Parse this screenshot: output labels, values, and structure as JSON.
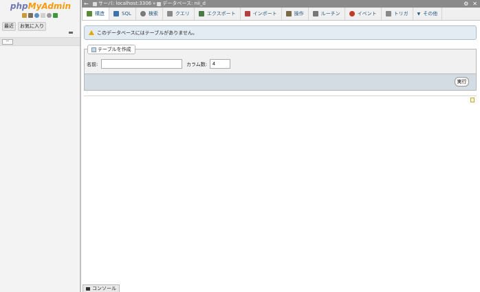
{
  "nav": {
    "logo_php": "php",
    "logo_myadmin": "MyAdmin",
    "icons": [
      "home-icon",
      "table-icon",
      "info-icon",
      "docs-icon",
      "settings-icon",
      "reload-icon"
    ],
    "recent_label": "最近",
    "favorites_label": "お気に入り",
    "tree_icon_label": "ー"
  },
  "topbar": {
    "collapse_glyph": "←",
    "server_label": "サーバ: localhost:3306",
    "separator": "»",
    "database_label": "データベース: nii_d",
    "settings_glyph": "⚙",
    "close_glyph": "✕"
  },
  "tabs": [
    {
      "name": "structure",
      "label": "構造",
      "icon": "structure-icon",
      "color": "#5a8a3a"
    },
    {
      "name": "sql",
      "label": "SQL",
      "icon": "sql-icon",
      "color": "#3f73a8"
    },
    {
      "name": "search",
      "label": "検索",
      "icon": "search-icon",
      "color": "#7a7a7a"
    },
    {
      "name": "query",
      "label": "クエリ",
      "icon": "query-icon",
      "color": "#8a8a8a"
    },
    {
      "name": "export",
      "label": "エクスポート",
      "icon": "export-icon",
      "color": "#4a7a4a"
    },
    {
      "name": "import",
      "label": "インポート",
      "icon": "import-icon",
      "color": "#b04040"
    },
    {
      "name": "operations",
      "label": "操作",
      "icon": "wrench-icon",
      "color": "#7a6a4a"
    },
    {
      "name": "routines",
      "label": "ルーチン",
      "icon": "routines-icon",
      "color": "#777777"
    },
    {
      "name": "events",
      "label": "イベント",
      "icon": "events-icon",
      "color": "#c0392b"
    },
    {
      "name": "triggers",
      "label": "トリガ",
      "icon": "triggers-icon",
      "color": "#888888"
    },
    {
      "name": "more",
      "label": "その他",
      "icon": "chevron-down-icon",
      "color": "#235a81"
    }
  ],
  "notice": {
    "message": "このデータベースにはテーブルがありません。"
  },
  "create_table": {
    "legend": "テーブルを作成",
    "name_label": "名前:",
    "name_value": "",
    "columns_label": "カラム数:",
    "columns_value": "4",
    "go_label": "実行"
  },
  "console": {
    "label": "コンソール"
  },
  "colors": {
    "accent": "#235a81",
    "topbar": "#8a8a8a",
    "notice_bg": "#e4ecf3",
    "footer_bg": "#d3dce3"
  }
}
